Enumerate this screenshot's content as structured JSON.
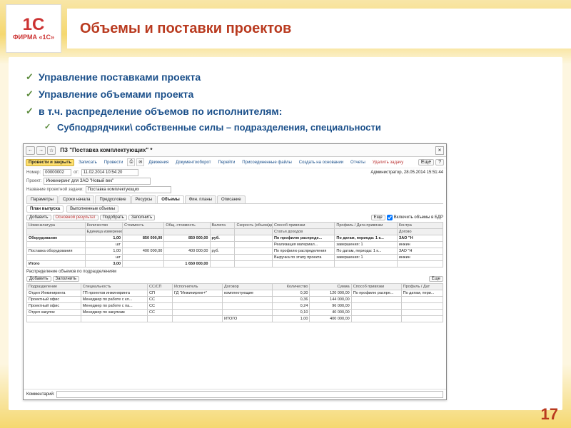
{
  "logo": {
    "big": "1C",
    "small": "ФИРМА «1С»"
  },
  "slide_title": "Объемы и поставки проектов",
  "bullets": [
    "Управление поставками проекта",
    "Управление объемами проекта",
    "в т.ч. распределение объемов по исполнителям:"
  ],
  "sub_bullets": [
    "Субподрядчики\\ собственные силы – подразделения, специальности"
  ],
  "page_number": "17",
  "window": {
    "nav": {
      "back": "←",
      "fwd": "→",
      "fav": "☆"
    },
    "title": "ПЗ \"Поставка комплектующих\" *",
    "close": "×",
    "actions": {
      "primary": "Провести и закрыть",
      "a1": "Записать",
      "a2": "Провести",
      "a3": "Движения",
      "a4": "Документооборот",
      "a5": "Перейти",
      "a6": "Присоединенные файлы",
      "a7": "Создать на основании",
      "a8": "Отчеты",
      "del": "Удалить задачу",
      "more": "Еще",
      "help": "?"
    },
    "header": {
      "num_label": "Номер:",
      "num": "00000002",
      "date_label": "от:",
      "date": "11.02.2014 10:54:20",
      "proj_label": "Проект:",
      "proj": "Инжиниринг для ЗАО \"Новый век\"",
      "name_label": "Название проектной задачи:",
      "name": "Поставка комплектующих",
      "admin": "Администратор, 28.05.2014 15:51:44"
    },
    "tabs": [
      "Параметры",
      "Сроки начала",
      "Предусловие",
      "Ресурсы",
      "Объемы",
      "Фин. планы",
      "Описание"
    ],
    "active_tab": 4,
    "subtabs": [
      "План выпуска",
      "Выполненные объемы"
    ],
    "active_subtab": 0,
    "tools1": {
      "add": "Добавить",
      "mark": "Основной результат",
      "pick": "Подобрать",
      "fill": "Заполнить",
      "more": "Еще",
      "chk": "Включить объемы в БДР"
    },
    "grid1": {
      "cols_top": [
        "Номенклатура",
        "Количество",
        "Стоимость",
        "Общ. стоимость",
        "Валюта",
        "Скорость (объем/день)",
        "Способ привязки",
        "Профиль / Дата привязки",
        "Контра"
      ],
      "cols_sub": [
        "",
        "Единица измерения",
        "",
        "",
        "",
        "",
        "Статья доходов",
        "",
        "Догово"
      ],
      "rows": [
        {
          "c": [
            "Оборудование",
            "1,00",
            "850 000,00",
            "850 000,00",
            "руб.",
            "",
            "По профилю распреде...",
            "По датам, периода: 1 к...",
            "ЗАО \"Н"
          ],
          "bold": true
        },
        {
          "c": [
            "",
            "шт",
            "",
            "",
            "",
            "",
            "Реализация материал...",
            "завершения: 1",
            "инжин"
          ]
        },
        {
          "c": [
            "Поставка оборудования",
            "1,00",
            "400 000,00",
            "400 000,00",
            "руб.",
            "",
            "По профилю распределения",
            "По датам, периода: 1 к...",
            "ЗАО \"Н"
          ]
        },
        {
          "c": [
            "",
            "шт",
            "",
            "",
            "",
            "",
            "Выручка по этапу проекта",
            "завершения: 1",
            "инжин"
          ]
        },
        {
          "c": [
            "Итого",
            "3,00",
            "",
            "1 650 000,00",
            "",
            "",
            "",
            "",
            ""
          ],
          "bold": true
        }
      ]
    },
    "section2": "Распределение объемов по подразделениям",
    "tools2": {
      "add": "Добавить",
      "fill": "Заполнить",
      "more": "Еще"
    },
    "grid2": {
      "cols": [
        "Подразделение",
        "Специальность",
        "СС/СП",
        "Исполнитель",
        "Договор",
        "Количество",
        "Сумма",
        "Способ привязки",
        "Профиль / Дат"
      ],
      "rows": [
        [
          "Отдел Инжиниринга",
          "ГП проектов инжиниринга",
          "СП",
          "ГД \"Инжиниринг+\"",
          "комплектующие",
          "0,30",
          "120 000,00",
          "По профилю распре...",
          "По датам, пери..."
        ],
        [
          "Проектный офис",
          "Менеджер по работе с кл...",
          "СС",
          "",
          "",
          "0,36",
          "144 000,00",
          "",
          ""
        ],
        [
          "Проектный офис",
          "Менеджер по работе с па...",
          "СС",
          "",
          "",
          "0,24",
          "96 000,00",
          "",
          ""
        ],
        [
          "Отдел закупок",
          "Менеджер по закупкам",
          "СС",
          "",
          "",
          "0,10",
          "40 000,00",
          "",
          ""
        ],
        [
          "",
          "",
          "",
          "",
          "ИТОГО",
          "1,00",
          "400 000,00",
          "",
          ""
        ]
      ]
    },
    "comment_label": "Комментарий:"
  }
}
